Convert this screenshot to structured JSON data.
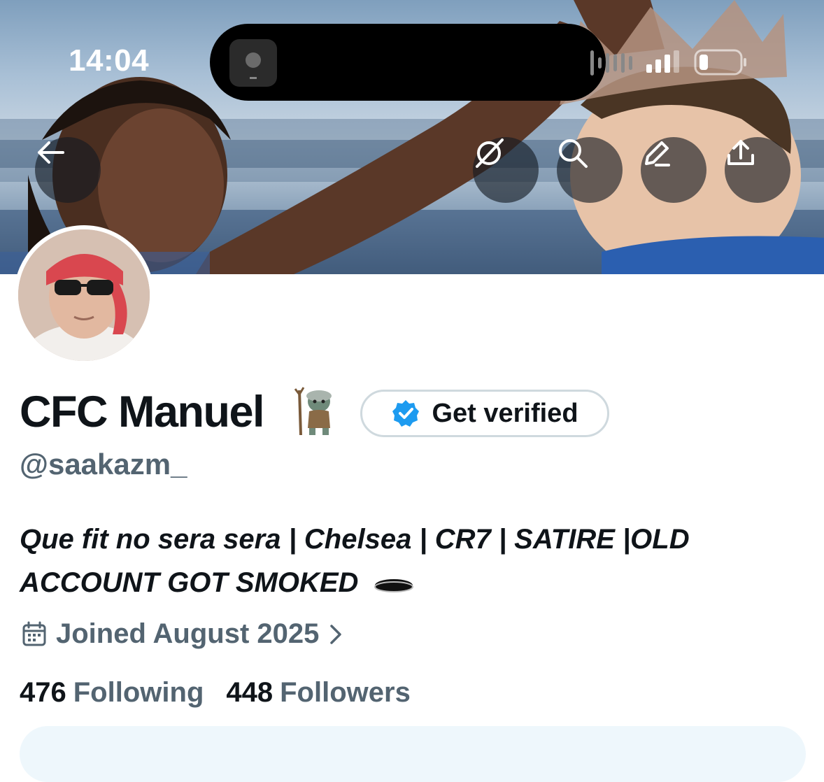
{
  "status_bar": {
    "time": "14:04"
  },
  "banner": {
    "buttons": [
      "back-arrow-icon",
      "grok-icon",
      "search-icon",
      "edit-icon",
      "share-icon"
    ]
  },
  "profile": {
    "display_name": "CFC Manuel",
    "name_emoji": "troll-emoji",
    "verify_button_label": "Get verified",
    "handle": "@saakazm_",
    "bio": "Que fit no sera sera | Chelsea | CR7 | SATIRE |OLD ACCOUNT GOT SMOKED",
    "joined": "Joined August 2025",
    "following_count": "476",
    "following_label": "Following",
    "followers_count": "448",
    "followers_label": "Followers"
  },
  "colors": {
    "primary_text": "#0f1419",
    "secondary_text": "#536471",
    "verify_blue": "#1d9bf0",
    "button_border": "#cfd9de"
  }
}
